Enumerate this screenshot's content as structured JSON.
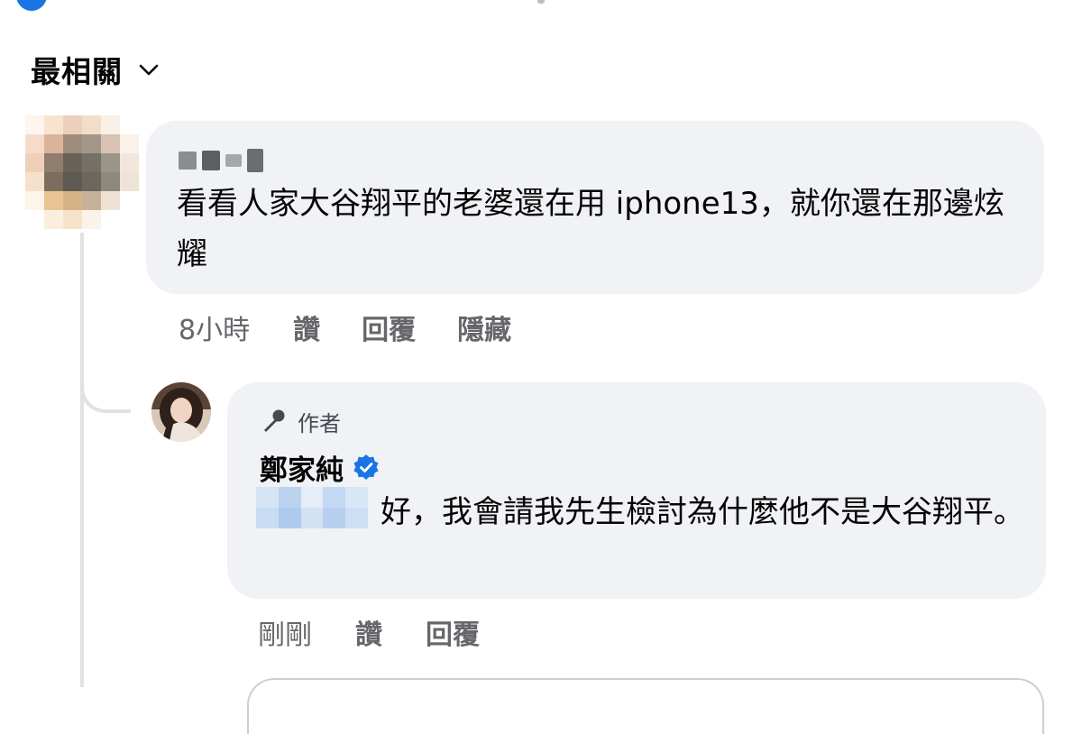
{
  "sort": {
    "label": "最相關"
  },
  "comments": [
    {
      "text": "看看人家大谷翔平的老婆還在用 iphone13，就你還在那邊炫耀",
      "actions": [
        "8小時",
        "讚",
        "回覆",
        "隱藏"
      ]
    }
  ],
  "reply": {
    "badge": "作者",
    "author": "鄭家純",
    "text": "好，我會請我先生檢討為什麼他不是大谷翔平。",
    "actions": [
      "剛剛",
      "讚",
      "回覆"
    ]
  },
  "colors": {
    "bubble_bg": "#f0f2f5",
    "secondary_text": "#65676b",
    "verified_blue": "#1b74e4"
  },
  "icons": [
    "chevron-down-icon",
    "microphone-icon",
    "verified-badge-icon"
  ]
}
